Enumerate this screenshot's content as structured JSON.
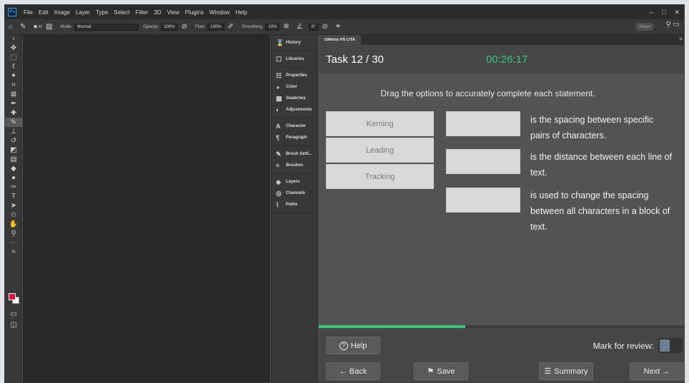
{
  "app": {
    "logo_text": "Ps",
    "menu": [
      "File",
      "Edit",
      "Image",
      "Layer",
      "Type",
      "Select",
      "Filter",
      "3D",
      "View",
      "Plugins",
      "Window",
      "Help"
    ],
    "window_controls": [
      "–",
      "□",
      "✕"
    ]
  },
  "options_bar": {
    "mode_label": "Mode:",
    "mode_value": "Normal",
    "opacity_label": "Opacity:",
    "opacity_value": "100%",
    "flow_label": "Flow:",
    "flow_value": "100%",
    "smoothing_label": "Smoothing:",
    "smoothing_value": "10%",
    "angle_value": "0°",
    "brush_size": "40",
    "share_label": "Share"
  },
  "panels": [
    [
      {
        "icon": "history-icon",
        "glyph": "⌛",
        "label": "History"
      }
    ],
    [
      {
        "icon": "libraries-icon",
        "glyph": "☐",
        "label": "Libraries"
      }
    ],
    [
      {
        "icon": "properties-icon",
        "glyph": "☷",
        "label": "Properties"
      },
      {
        "icon": "color-icon",
        "glyph": "◕",
        "label": "Color"
      },
      {
        "icon": "swatches-icon",
        "glyph": "▦",
        "label": "Swatches"
      },
      {
        "icon": "adjustments-icon",
        "glyph": "◐",
        "label": "Adjustments"
      }
    ],
    [
      {
        "icon": "character-icon",
        "glyph": "A",
        "label": "Character"
      },
      {
        "icon": "paragraph-icon",
        "glyph": "¶",
        "label": "Paragraph"
      }
    ],
    [
      {
        "icon": "brush-settings-icon",
        "glyph": "✎",
        "label": "Brush Setti..."
      },
      {
        "icon": "brushes-icon",
        "glyph": "≈",
        "label": "Brushes"
      }
    ],
    [
      {
        "icon": "layers-icon",
        "glyph": "◈",
        "label": "Layers"
      },
      {
        "icon": "channels-icon",
        "glyph": "◎",
        "label": "Channels"
      },
      {
        "icon": "paths-icon",
        "glyph": "⌇",
        "label": "Paths"
      }
    ]
  ],
  "gmetrix": {
    "tab_label": "GMetrix PS LITA",
    "task_title": "Task 12 / 30",
    "timer": "00:26:17",
    "instruction": "Drag the options to accurately complete each statement.",
    "options": [
      "Kerning",
      "Leading",
      "Tracking"
    ],
    "statements": [
      "is the spacing between specific pairs of characters.",
      "is the distance between each line of text.",
      "is used to change the spacing between all characters in a block of text."
    ],
    "progress_fraction": 0.4,
    "help_label": "Help",
    "mark_label": "Mark for review:",
    "back_label": "← Back",
    "save_label": "Save",
    "summary_label": "Summary",
    "next_label": "Next →",
    "accent_color": "#3ec27a"
  }
}
